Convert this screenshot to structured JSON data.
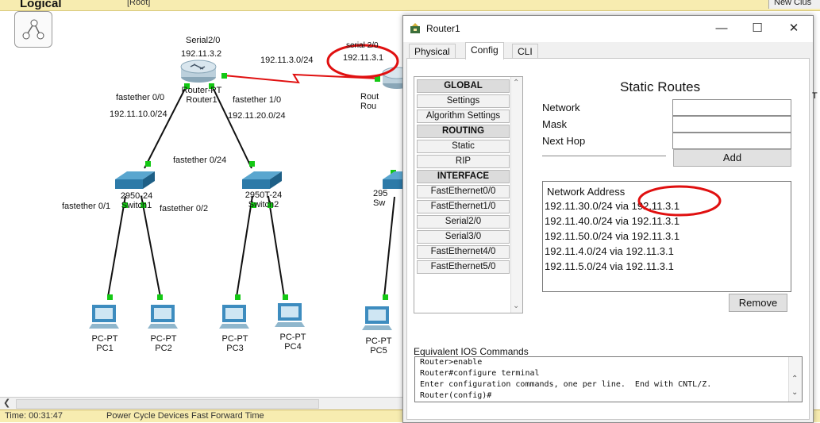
{
  "workspace": {
    "mode": "Logical",
    "root": "[Root]",
    "new_cluster": "New Clus",
    "labels": {
      "serial20": "Serial2/0",
      "r1_ip": "192.11.3.2",
      "link_net": "192.11.3.0/24",
      "serial20_b": "serial 2/0",
      "r2_ip": "192.11.3.1",
      "fe00": "fastether 0/0",
      "net10": "192.11.10.0/24",
      "fe10": "fastether 1/0",
      "net20": "192.11.20.0/24",
      "fe024": "fastether 0/24",
      "fe01": "fastether 0/1",
      "fe02": "fastether 0/2"
    },
    "devices": {
      "router1": {
        "type": "Router-PT",
        "name": "Router1"
      },
      "router2": {
        "type": "Rout",
        "name": "Rou"
      },
      "switch1": {
        "type": "2950-24",
        "name": "Switch1"
      },
      "switch2": {
        "type": "2950T-24",
        "name": "Switch2"
      },
      "switch3": {
        "type": "295",
        "name": "Sw"
      },
      "pc1": {
        "type": "PC-PT",
        "name": "PC1"
      },
      "pc2": {
        "type": "PC-PT",
        "name": "PC2"
      },
      "pc3": {
        "type": "PC-PT",
        "name": "PC3"
      },
      "pc4": {
        "type": "PC-PT",
        "name": "PC4"
      },
      "pc5": {
        "type": "PC-PT",
        "name": "PC5"
      }
    },
    "status_bar": {
      "time": "Time: 00:31:47",
      "power": "Power Cycle Devices  Fast Forward Time"
    }
  },
  "dialog": {
    "title": "Router1",
    "tabs": [
      "Physical",
      "Config",
      "CLI"
    ],
    "active_tab": "Config",
    "sidebar": [
      {
        "label": "GLOBAL",
        "header": true
      },
      {
        "label": "Settings",
        "header": false
      },
      {
        "label": "Algorithm Settings",
        "header": false
      },
      {
        "label": "ROUTING",
        "header": true
      },
      {
        "label": "Static",
        "header": false
      },
      {
        "label": "RIP",
        "header": false
      },
      {
        "label": "INTERFACE",
        "header": true
      },
      {
        "label": "FastEthernet0/0",
        "header": false
      },
      {
        "label": "FastEthernet1/0",
        "header": false
      },
      {
        "label": "Serial2/0",
        "header": false
      },
      {
        "label": "Serial3/0",
        "header": false
      },
      {
        "label": "FastEthernet4/0",
        "header": false
      },
      {
        "label": "FastEthernet5/0",
        "header": false
      }
    ],
    "static_routes": {
      "title": "Static Routes",
      "network_label": "Network",
      "mask_label": "Mask",
      "next_hop_label": "Next Hop",
      "network_value": "",
      "mask_value": "",
      "next_hop_value": "",
      "add_label": "Add",
      "list_header": "Network Address",
      "routes": [
        "192.11.30.0/24 via 192.11.3.1",
        "192.11.40.0/24 via 192.11.3.1",
        "192.11.50.0/24 via 192.11.3.1",
        "192.11.4.0/24 via 192.11.3.1",
        "192.11.5.0/24 via 192.11.3.1"
      ],
      "remove_label": "Remove"
    },
    "ios": {
      "label": "Equivalent IOS Commands",
      "lines": [
        "Router>enable",
        "Router#configure terminal",
        "Enter configuration commands, one per line.  End with CNTL/Z.",
        "Router(config)#"
      ]
    }
  },
  "colors": {
    "annotation_red": "#e01010",
    "link_green": "#14c814",
    "serial_red": "#e01010",
    "device_blue": "#2d7aa8"
  }
}
